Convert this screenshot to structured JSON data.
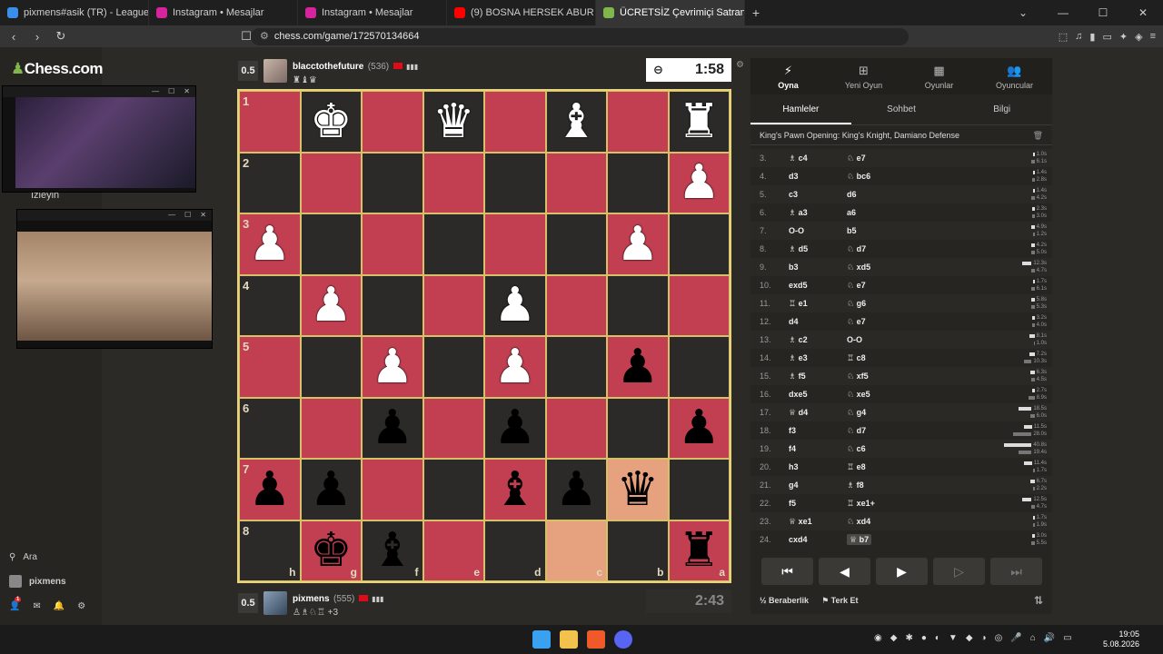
{
  "browser": {
    "tabs": [
      {
        "label": "pixmens#asik (TR) - LeagueOfGraphs",
        "color": "#3b8eea",
        "active": false
      },
      {
        "label": "Instagram • Mesajlar",
        "color": "#d6249f",
        "active": false
      },
      {
        "label": "Instagram • Mesajlar",
        "color": "#d6249f",
        "active": false
      },
      {
        "label": "(9) BOSNA HERSEK ABUR CUBURLAR",
        "color": "#ff0000",
        "active": false
      },
      {
        "label": "ÜCRETSİZ Çevrimiçi Satranç Oyna",
        "color": "#81b64c",
        "active": true
      }
    ],
    "url": "chess.com/game/172570134664",
    "new_tab": "+",
    "tab_close": "✕"
  },
  "sidebar": {
    "logo": "Chess.com",
    "watch_label": "İzleyin",
    "search_label": "Ara",
    "username": "pixmens",
    "notif_count": "1"
  },
  "top_player": {
    "score": "0.5",
    "name": "blacctothefuture",
    "rating": "(536)",
    "captured": "♜♝♛"
  },
  "bottom_player": {
    "score": "0.5",
    "name": "pixmens",
    "rating": "(555)",
    "captured": "♙♗♘♖ +3"
  },
  "clocks": {
    "top": "1:58",
    "bottom": "2:43"
  },
  "board": {
    "ranks": [
      "1",
      "2",
      "3",
      "4",
      "5",
      "6",
      "7",
      "8"
    ],
    "files": [
      "h",
      "g",
      "f",
      "e",
      "d",
      "c",
      "b",
      "a"
    ],
    "rows": [
      [
        "r",
        "d",
        "r",
        "d",
        "r",
        "d",
        "r",
        "d"
      ],
      [
        "d",
        "r",
        "d",
        "r",
        "d",
        "r",
        "d",
        "r"
      ],
      [
        "r",
        "d",
        "r",
        "d",
        "r",
        "d",
        "r",
        "d"
      ],
      [
        "d",
        "r",
        "d",
        "r",
        "d",
        "r",
        "d",
        "r"
      ],
      [
        "r",
        "d",
        "r",
        "d",
        "r",
        "d",
        "r",
        "d"
      ],
      [
        "d",
        "r",
        "d",
        "r",
        "d",
        "r",
        "d",
        "r"
      ],
      [
        "r",
        "d",
        "r",
        "d",
        "r",
        "d",
        "hl",
        "d"
      ],
      [
        "d",
        "r",
        "d",
        "r",
        "d",
        "hl",
        "d",
        "r"
      ]
    ],
    "pieces": [
      [
        "",
        "wK",
        "",
        "wQ",
        "",
        "wB",
        "",
        "wR"
      ],
      [
        "",
        "",
        "",
        "",
        "",
        "",
        "",
        "wP"
      ],
      [
        "wP",
        "",
        "",
        "",
        "",
        "",
        "wP",
        ""
      ],
      [
        "",
        "wP",
        "",
        "",
        "wP",
        "",
        "",
        ""
      ],
      [
        "",
        "",
        "wP",
        "",
        "wP",
        "",
        "bP",
        ""
      ],
      [
        "",
        "",
        "bP",
        "",
        "bP",
        "",
        "",
        "bP"
      ],
      [
        "bP",
        "bP",
        "",
        "",
        "bB",
        "bP",
        "bQ",
        ""
      ],
      [
        "",
        "bK",
        "bB",
        "",
        "",
        "",
        "",
        "bR"
      ]
    ]
  },
  "panel": {
    "tabs": [
      {
        "label": "Oyna",
        "icon": "⚡",
        "active": true
      },
      {
        "label": "Yeni Oyun",
        "icon": "⊞",
        "active": false
      },
      {
        "label": "Oyunlar",
        "icon": "▦",
        "active": false
      },
      {
        "label": "Oyuncular",
        "icon": "👥",
        "active": false
      }
    ],
    "subtabs": [
      {
        "label": "Hamleler",
        "active": true
      },
      {
        "label": "Sohbet",
        "active": false
      },
      {
        "label": "Bilgi",
        "active": false
      }
    ],
    "opening": "King's Pawn Opening: King's Knight, Damiano Defense",
    "moves": [
      {
        "n": "3.",
        "w": "♗ c4",
        "b": "♘ e7",
        "tw": "1.0s",
        "tb": "6.1s",
        "fw": 0.05,
        "fb": 0.1
      },
      {
        "n": "4.",
        "w": "d3",
        "b": "♘ bc6",
        "tw": "1.4s",
        "tb": "2.8s",
        "fw": 0.05,
        "fb": 0.07
      },
      {
        "n": "5.",
        "w": "c3",
        "b": "d6",
        "tw": "1.4s",
        "tb": "4.2s",
        "fw": 0.05,
        "fb": 0.09
      },
      {
        "n": "6.",
        "w": "♗ a3",
        "b": "a6",
        "tw": "2.3s",
        "tb": "3.0s",
        "fw": 0.07,
        "fb": 0.08
      },
      {
        "n": "7.",
        "w": "O-O",
        "b": "b5",
        "tw": "4.9s",
        "tb": "1.2s",
        "fw": 0.1,
        "fb": 0.04
      },
      {
        "n": "8.",
        "w": "♗ d5",
        "b": "♘ d7",
        "tw": "4.2s",
        "tb": "5.0s",
        "fw": 0.09,
        "fb": 0.1
      },
      {
        "n": "9.",
        "w": "b3",
        "b": "♘ xd5",
        "tw": "12.3s",
        "tb": "4.7s",
        "fw": 0.25,
        "fb": 0.1
      },
      {
        "n": "10.",
        "w": "exd5",
        "b": "♘ e7",
        "tw": "1.7s",
        "tb": "6.1s",
        "fw": 0.05,
        "fb": 0.1
      },
      {
        "n": "11.",
        "w": "♖ e1",
        "b": "♘ g6",
        "tw": "5.8s",
        "tb": "5.3s",
        "fw": 0.11,
        "fb": 0.1
      },
      {
        "n": "12.",
        "w": "d4",
        "b": "♘ e7",
        "tw": "3.2s",
        "tb": "4.0s",
        "fw": 0.07,
        "fb": 0.08
      },
      {
        "n": "13.",
        "w": "♗ c2",
        "b": "O-O",
        "tw": "8.1s",
        "tb": "1.0s",
        "fw": 0.16,
        "fb": 0.03
      },
      {
        "n": "14.",
        "w": "♗ e3",
        "b": "♖ c8",
        "tw": "7.2s",
        "tb": "10.3s",
        "fw": 0.14,
        "fb": 0.2
      },
      {
        "n": "15.",
        "w": "♗ f5",
        "b": "♘ xf5",
        "tw": "6.3s",
        "tb": "4.5s",
        "fw": 0.13,
        "fb": 0.09
      },
      {
        "n": "16.",
        "w": "dxe5",
        "b": "♘ xe5",
        "tw": "2.7s",
        "tb": "8.9s",
        "fw": 0.07,
        "fb": 0.17
      },
      {
        "n": "17.",
        "w": "♕ d4",
        "b": "♘ g4",
        "tw": "18.5s",
        "tb": "6.0s",
        "fw": 0.35,
        "fb": 0.12
      },
      {
        "n": "18.",
        "w": "f3",
        "b": "♘ d7",
        "tw": "11.5s",
        "tb": "28.0s",
        "fw": 0.22,
        "fb": 0.5
      },
      {
        "n": "19.",
        "w": "f4",
        "b": "♘ c6",
        "tw": "40.8s",
        "tb": "19.4s",
        "fw": 0.75,
        "fb": 0.36
      },
      {
        "n": "20.",
        "w": "h3",
        "b": "♖ e8",
        "tw": "11.4s",
        "tb": "1.7s",
        "fw": 0.22,
        "fb": 0.05
      },
      {
        "n": "21.",
        "w": "g4",
        "b": "♗ f8",
        "tw": "6.7s",
        "tb": "2.2s",
        "fw": 0.13,
        "fb": 0.06
      },
      {
        "n": "22.",
        "w": "f5",
        "b": "♖ xe1+",
        "tw": "12.5s",
        "tb": "4.7s",
        "fw": 0.25,
        "fb": 0.1
      },
      {
        "n": "23.",
        "w": "♕ xe1",
        "b": "♘ xd4",
        "tw": "1.7s",
        "tb": "1.9s",
        "fw": 0.05,
        "fb": 0.05
      },
      {
        "n": "24.",
        "w": "cxd4",
        "b": "♕ b7",
        "tw": "3.0s",
        "tb": "5.5s",
        "fw": 0.07,
        "fb": 0.1,
        "current": true
      }
    ],
    "controls": [
      "⏮",
      "◀",
      "▶",
      "▷",
      "⏭"
    ],
    "draw_label": "Beraberlik",
    "draw_icon": "½",
    "resign_label": "Terk Et",
    "resign_icon": "⚑",
    "flip_icon": "⇅"
  },
  "taskbar": {
    "time": "19:05",
    "date": "5.08.2026"
  }
}
